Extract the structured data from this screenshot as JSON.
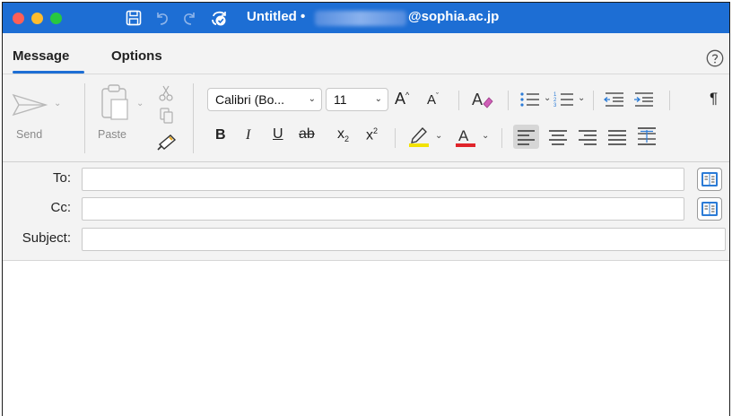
{
  "titlebar": {
    "title": "Untitled •",
    "account_domain": "@sophia.ac.jp"
  },
  "tabs": [
    {
      "label": "Message",
      "active": true
    },
    {
      "label": "Options",
      "active": false
    }
  ],
  "ribbon": {
    "send_label": "Send",
    "paste_label": "Paste",
    "font_name": "Calibri (Bo...",
    "font_size": "11",
    "bold": "B",
    "italic": "I",
    "underline": "U",
    "strike": "ab",
    "grow_font": "A",
    "shrink_font": "A",
    "font_color": "A",
    "pilcrow": "¶"
  },
  "fields": {
    "to_label": "To:",
    "cc_label": "Cc:",
    "subject_label": "Subject:",
    "to_value": "",
    "cc_value": "",
    "subject_value": ""
  },
  "colors": {
    "titlebar": "#1d6ed4",
    "highlight": "#f2e200",
    "font_color": "#e0242a"
  }
}
